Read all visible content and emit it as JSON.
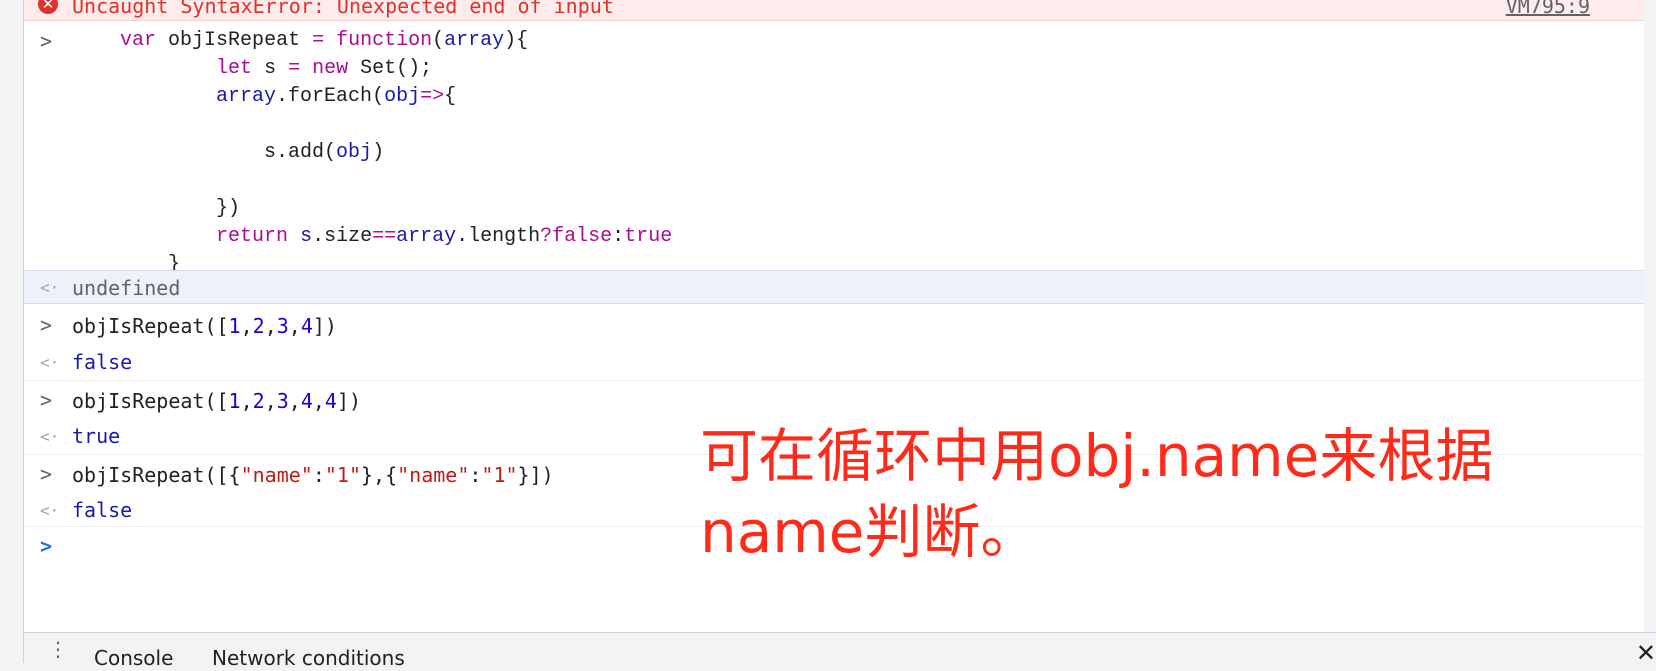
{
  "error": {
    "icon": "error-circle-icon",
    "message": "Uncaught SyntaxError: Unexpected end of input",
    "source": "VM795:9"
  },
  "entries": {
    "input_1": {
      "lines": [
        "    var objIsRepeat = function(array){",
        "            let s = new Set();",
        "            array.forEach(obj=>{",
        "",
        "                s.add(obj)",
        "",
        "            })",
        "            return s.size==array.length?false:true",
        "        }"
      ]
    },
    "result_1": "undefined",
    "input_2": "objIsRepeat([1,2,3,4])",
    "result_2": "false",
    "input_3": "objIsRepeat([1,2,3,4,4])",
    "result_3": "true",
    "input_4": "objIsRepeat([{\"name\":\"1\"},{\"name\":\"1\"}])",
    "result_4": "false"
  },
  "prompt_symbol": ">",
  "result_symbol": "<·",
  "annotation": {
    "line1": "可在循环中用obj.name来根据",
    "line2": "name判断。",
    "color": "#ff2a1a"
  },
  "drawer": {
    "menu_icon": "kebab-menu-icon",
    "tabs": [
      "Console",
      "Network conditions"
    ],
    "close_icon": "close-icon",
    "close_glyph": "✕"
  }
}
